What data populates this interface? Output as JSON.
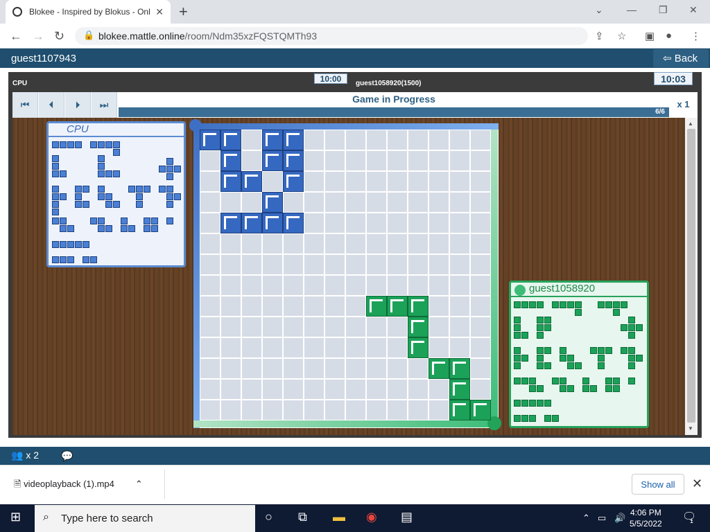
{
  "browser": {
    "tab_title": "Blokee - Inspired by Blokus - Onl",
    "url_host": "blokee.mattle.online",
    "url_path": "/room/Ndm35xzFQSTQMTh93"
  },
  "app": {
    "user": "guest1107943",
    "back_label": "Back",
    "cpu_label": "CPU",
    "opponent": "guest1058920(1500)",
    "timer_left": "10:00",
    "timer_right": "10:03",
    "status": "Game in Progress",
    "progress": "6/6",
    "speed": "x 1"
  },
  "trays": {
    "cpu_title": "CPU",
    "guest_title": "guest1058920"
  },
  "board": {
    "size": 14,
    "blue_cells": [
      [
        0,
        0
      ],
      [
        0,
        1
      ],
      [
        0,
        3
      ],
      [
        0,
        4
      ],
      [
        1,
        1
      ],
      [
        1,
        3
      ],
      [
        1,
        4
      ],
      [
        2,
        1
      ],
      [
        2,
        2
      ],
      [
        2,
        4
      ],
      [
        3,
        3
      ],
      [
        4,
        1
      ],
      [
        4,
        2
      ],
      [
        4,
        3
      ],
      [
        4,
        4
      ]
    ],
    "green_cells": [
      [
        8,
        8
      ],
      [
        8,
        9
      ],
      [
        8,
        10
      ],
      [
        9,
        10
      ],
      [
        10,
        10
      ],
      [
        11,
        11
      ],
      [
        11,
        12
      ],
      [
        12,
        12
      ],
      [
        13,
        12
      ],
      [
        13,
        13
      ]
    ]
  },
  "footer": {
    "users": "x 2",
    "download_file": "videoplayback (1).mp4",
    "show_all": "Show all"
  },
  "taskbar": {
    "search_placeholder": "Type here to search",
    "time": "4:06 PM",
    "date": "5/5/2022",
    "notif": "1"
  },
  "colors": {
    "blue": "#3568c0",
    "green": "#1ba158",
    "header": "#1f4e6e"
  }
}
